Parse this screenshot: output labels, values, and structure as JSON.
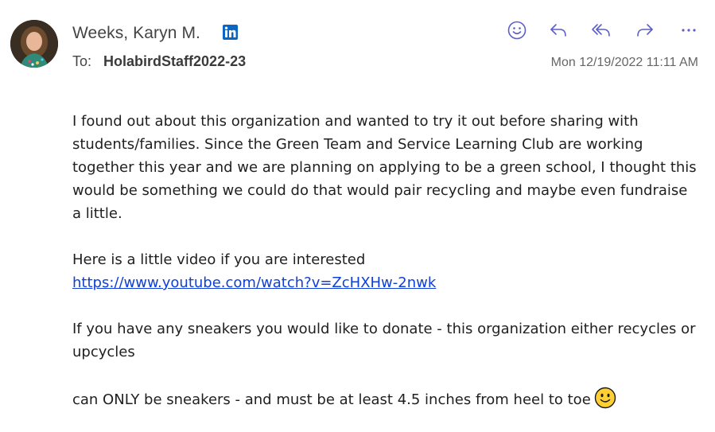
{
  "sender": {
    "name": "Weeks, Karyn M.",
    "avatar_icon": "person-photo-avatar",
    "badge_icon": "linkedin-icon"
  },
  "recipients": {
    "to_label": "To:",
    "to_value": "HolabirdStaff2022-23"
  },
  "timestamp": "Mon 12/19/2022 11:11 AM",
  "toolbar": {
    "icons": [
      "emoji-react-icon",
      "reply-icon",
      "reply-all-icon",
      "forward-icon",
      "more-icon"
    ]
  },
  "message": {
    "paragraph1": "I found out about this organization and wanted to try it out before sharing with students/families.  Since the Green Team and Service Learning Club are working together this year and we are planning on applying to be a green school, I thought this would be something we could do that would pair recycling and maybe even fundraise a little.",
    "paragraph2_text": "Here is a little video if you are interested",
    "video_link": "https://www.youtube.com/watch?v=ZcHXHw-2nwk",
    "paragraph3": "If you have any sneakers you would like to donate - this organization either recycles or upcycles",
    "paragraph4": "can ONLY be sneakers - and must be at least 4.5 inches from heel to toe",
    "closing_emoji": "slightly-smiling-face-emoji"
  },
  "colors": {
    "accent": "#5b5fc7",
    "link": "#0f3fd6",
    "linkedin": "#0a66c2",
    "emoji_yellow": "#ffcf33"
  }
}
